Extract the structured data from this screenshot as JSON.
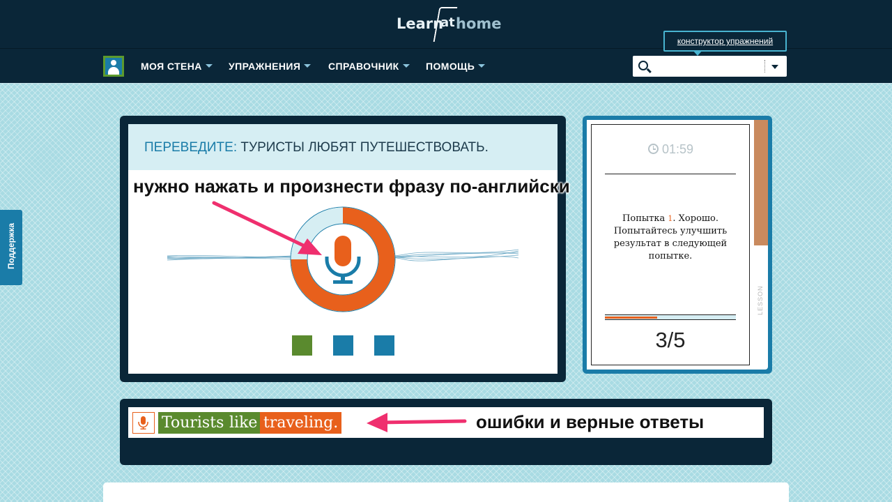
{
  "header": {
    "logo_learn": "Learn",
    "logo_at": "at",
    "logo_home": "home",
    "builder_link": "конструктор упражнений"
  },
  "nav": {
    "items": [
      {
        "label": "МОЯ СТЕНА"
      },
      {
        "label": "УПРАЖНЕНИЯ"
      },
      {
        "label": "СПРАВОЧНИК"
      },
      {
        "label": "ПОМОЩЬ"
      }
    ],
    "search_placeholder": ""
  },
  "support_tab": "Поддержка",
  "exercise": {
    "prompt_key": "ПЕРЕВЕДИТЕ:",
    "prompt_text": "ТУРИСТЫ ЛЮБЯТ ПУТЕШЕСТВОВАТЬ.",
    "recording_progress": 0.75,
    "dots": [
      {
        "color": "#5a8a2e"
      },
      {
        "color": "#1a7ca8"
      },
      {
        "color": "#1a7ca8"
      }
    ]
  },
  "lesson": {
    "timer": "01:59",
    "feedback_pre": "Попытка ",
    "feedback_num": "1",
    "feedback_post": ". Хорошо. Попытайтесь улучшить результат в следующей попытке.",
    "progress_fraction": 0.4,
    "counter": "3/5",
    "side_label": "LESSON"
  },
  "answer": {
    "words": [
      {
        "text": "Tourists",
        "status": "correct",
        "color": "#5a8a2e"
      },
      {
        "text": "like",
        "status": "correct",
        "color": "#5a8a2e"
      },
      {
        "text": "traveling.",
        "status": "error",
        "color": "#e8601c"
      }
    ]
  },
  "annotations": {
    "top": "нужно нажать и произнести фразу по-английски",
    "bottom": "ошибки и верные ответы"
  },
  "colors": {
    "dark": "#0a2638",
    "accent_blue": "#1a7ca8",
    "accent_orange": "#e8601c",
    "green": "#5a8a2e",
    "arrow_pink": "#ef2f6e"
  }
}
